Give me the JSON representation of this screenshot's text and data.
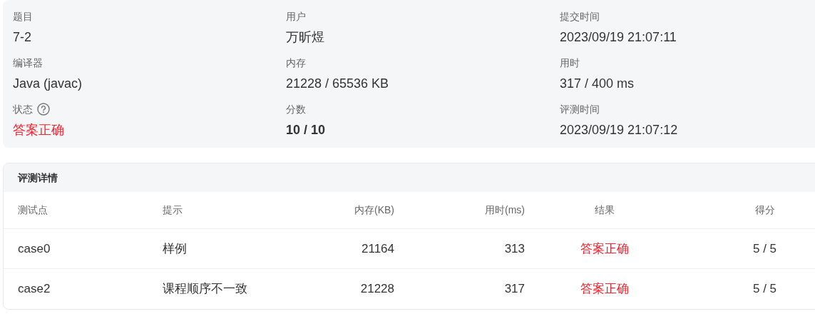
{
  "summary": [
    {
      "label": "题目",
      "value": "7-2",
      "kind": "plain"
    },
    {
      "label": "用户",
      "value": "万昕煜",
      "kind": "plain"
    },
    {
      "label": "提交时间",
      "value": "2023/09/19 21:07:11",
      "kind": "plain"
    },
    {
      "label": "编译器",
      "value": "Java (javac)",
      "kind": "plain"
    },
    {
      "label": "内存",
      "value": "21228 / 65536 KB",
      "kind": "plain"
    },
    {
      "label": "用时",
      "value": "317 / 400 ms",
      "kind": "plain"
    },
    {
      "label": "状态",
      "value": "答案正确",
      "kind": "status",
      "color": "#f5222d"
    },
    {
      "label": "分数",
      "value": "10 / 10",
      "kind": "score"
    },
    {
      "label": "评测时间",
      "value": "2023/09/19 21:07:12",
      "kind": "plain"
    }
  ],
  "details": {
    "title": "评测详情",
    "columns": [
      "测试点",
      "提示",
      "内存(KB)",
      "用时(ms)",
      "结果",
      "得分"
    ],
    "rows": [
      {
        "case": "case0",
        "hint": "样例",
        "memory": "21164",
        "time": "313",
        "result": "答案正确",
        "color": "#f5222d",
        "score": "5 / 5"
      },
      {
        "case": "case2",
        "hint": "课程顺序不一致",
        "memory": "21228",
        "time": "317",
        "result": "答案正确",
        "color": "#f5222d",
        "score": "5 / 5"
      }
    ]
  }
}
